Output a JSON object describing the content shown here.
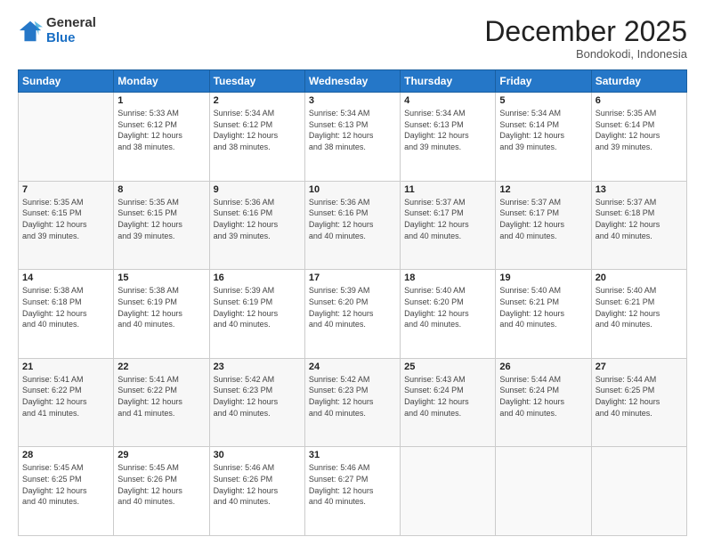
{
  "header": {
    "logo_line1": "General",
    "logo_line2": "Blue",
    "month_title": "December 2025",
    "subtitle": "Bondokodi, Indonesia"
  },
  "days_of_week": [
    "Sunday",
    "Monday",
    "Tuesday",
    "Wednesday",
    "Thursday",
    "Friday",
    "Saturday"
  ],
  "weeks": [
    [
      {
        "num": "",
        "info": ""
      },
      {
        "num": "1",
        "info": "Sunrise: 5:33 AM\nSunset: 6:12 PM\nDaylight: 12 hours\nand 38 minutes."
      },
      {
        "num": "2",
        "info": "Sunrise: 5:34 AM\nSunset: 6:12 PM\nDaylight: 12 hours\nand 38 minutes."
      },
      {
        "num": "3",
        "info": "Sunrise: 5:34 AM\nSunset: 6:13 PM\nDaylight: 12 hours\nand 38 minutes."
      },
      {
        "num": "4",
        "info": "Sunrise: 5:34 AM\nSunset: 6:13 PM\nDaylight: 12 hours\nand 39 minutes."
      },
      {
        "num": "5",
        "info": "Sunrise: 5:34 AM\nSunset: 6:14 PM\nDaylight: 12 hours\nand 39 minutes."
      },
      {
        "num": "6",
        "info": "Sunrise: 5:35 AM\nSunset: 6:14 PM\nDaylight: 12 hours\nand 39 minutes."
      }
    ],
    [
      {
        "num": "7",
        "info": "Sunrise: 5:35 AM\nSunset: 6:15 PM\nDaylight: 12 hours\nand 39 minutes."
      },
      {
        "num": "8",
        "info": "Sunrise: 5:35 AM\nSunset: 6:15 PM\nDaylight: 12 hours\nand 39 minutes."
      },
      {
        "num": "9",
        "info": "Sunrise: 5:36 AM\nSunset: 6:16 PM\nDaylight: 12 hours\nand 39 minutes."
      },
      {
        "num": "10",
        "info": "Sunrise: 5:36 AM\nSunset: 6:16 PM\nDaylight: 12 hours\nand 40 minutes."
      },
      {
        "num": "11",
        "info": "Sunrise: 5:37 AM\nSunset: 6:17 PM\nDaylight: 12 hours\nand 40 minutes."
      },
      {
        "num": "12",
        "info": "Sunrise: 5:37 AM\nSunset: 6:17 PM\nDaylight: 12 hours\nand 40 minutes."
      },
      {
        "num": "13",
        "info": "Sunrise: 5:37 AM\nSunset: 6:18 PM\nDaylight: 12 hours\nand 40 minutes."
      }
    ],
    [
      {
        "num": "14",
        "info": "Sunrise: 5:38 AM\nSunset: 6:18 PM\nDaylight: 12 hours\nand 40 minutes."
      },
      {
        "num": "15",
        "info": "Sunrise: 5:38 AM\nSunset: 6:19 PM\nDaylight: 12 hours\nand 40 minutes."
      },
      {
        "num": "16",
        "info": "Sunrise: 5:39 AM\nSunset: 6:19 PM\nDaylight: 12 hours\nand 40 minutes."
      },
      {
        "num": "17",
        "info": "Sunrise: 5:39 AM\nSunset: 6:20 PM\nDaylight: 12 hours\nand 40 minutes."
      },
      {
        "num": "18",
        "info": "Sunrise: 5:40 AM\nSunset: 6:20 PM\nDaylight: 12 hours\nand 40 minutes."
      },
      {
        "num": "19",
        "info": "Sunrise: 5:40 AM\nSunset: 6:21 PM\nDaylight: 12 hours\nand 40 minutes."
      },
      {
        "num": "20",
        "info": "Sunrise: 5:40 AM\nSunset: 6:21 PM\nDaylight: 12 hours\nand 40 minutes."
      }
    ],
    [
      {
        "num": "21",
        "info": "Sunrise: 5:41 AM\nSunset: 6:22 PM\nDaylight: 12 hours\nand 41 minutes."
      },
      {
        "num": "22",
        "info": "Sunrise: 5:41 AM\nSunset: 6:22 PM\nDaylight: 12 hours\nand 41 minutes."
      },
      {
        "num": "23",
        "info": "Sunrise: 5:42 AM\nSunset: 6:23 PM\nDaylight: 12 hours\nand 40 minutes."
      },
      {
        "num": "24",
        "info": "Sunrise: 5:42 AM\nSunset: 6:23 PM\nDaylight: 12 hours\nand 40 minutes."
      },
      {
        "num": "25",
        "info": "Sunrise: 5:43 AM\nSunset: 6:24 PM\nDaylight: 12 hours\nand 40 minutes."
      },
      {
        "num": "26",
        "info": "Sunrise: 5:44 AM\nSunset: 6:24 PM\nDaylight: 12 hours\nand 40 minutes."
      },
      {
        "num": "27",
        "info": "Sunrise: 5:44 AM\nSunset: 6:25 PM\nDaylight: 12 hours\nand 40 minutes."
      }
    ],
    [
      {
        "num": "28",
        "info": "Sunrise: 5:45 AM\nSunset: 6:25 PM\nDaylight: 12 hours\nand 40 minutes."
      },
      {
        "num": "29",
        "info": "Sunrise: 5:45 AM\nSunset: 6:26 PM\nDaylight: 12 hours\nand 40 minutes."
      },
      {
        "num": "30",
        "info": "Sunrise: 5:46 AM\nSunset: 6:26 PM\nDaylight: 12 hours\nand 40 minutes."
      },
      {
        "num": "31",
        "info": "Sunrise: 5:46 AM\nSunset: 6:27 PM\nDaylight: 12 hours\nand 40 minutes."
      },
      {
        "num": "",
        "info": ""
      },
      {
        "num": "",
        "info": ""
      },
      {
        "num": "",
        "info": ""
      }
    ]
  ]
}
